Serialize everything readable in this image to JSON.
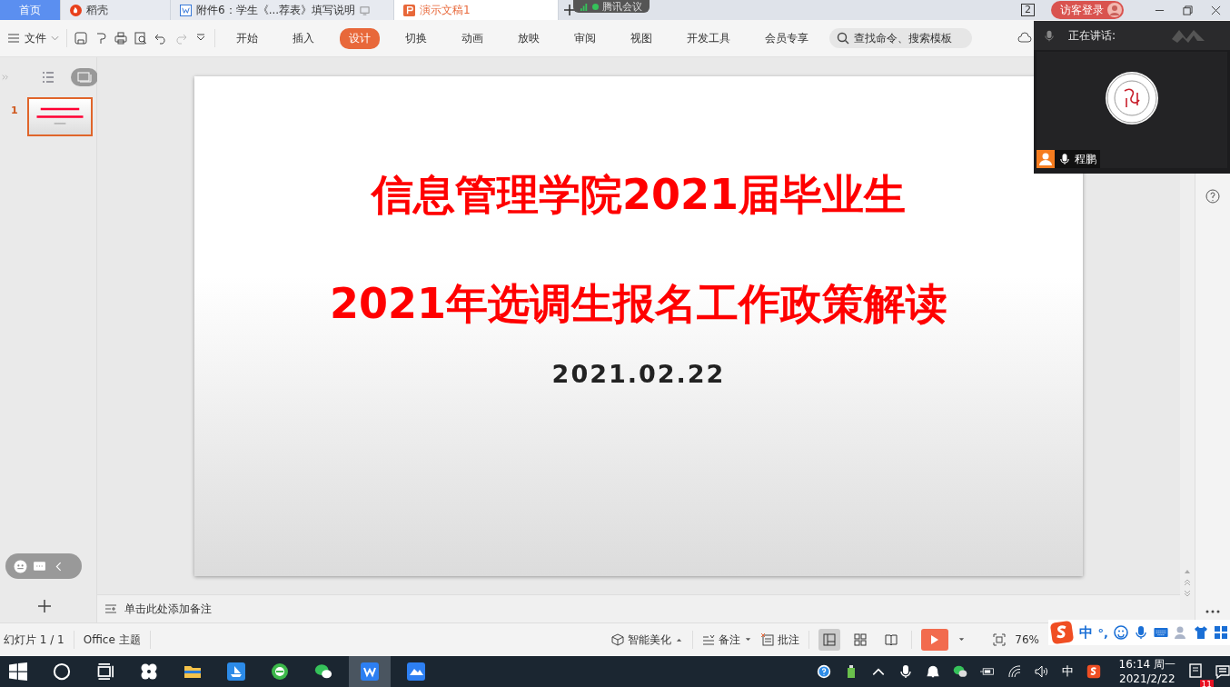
{
  "tabs": [
    {
      "label": "首页",
      "selected": false,
      "kind": "home"
    },
    {
      "label": "稻壳",
      "selected": false,
      "kind": "docer"
    },
    {
      "label": "附件6：学生《...荐表》填写说明",
      "selected": false,
      "kind": "writer"
    },
    {
      "label": "演示文稿1",
      "selected": true,
      "kind": "slides"
    }
  ],
  "meeting_pill": {
    "label": "腾讯会议"
  },
  "window_count": "2",
  "login_button": "访客登录",
  "file_menu": "文件",
  "ribbon_tabs": [
    {
      "label": "开始",
      "selected": false
    },
    {
      "label": "插入",
      "selected": false
    },
    {
      "label": "设计",
      "selected": true
    },
    {
      "label": "切换",
      "selected": false
    },
    {
      "label": "动画",
      "selected": false
    },
    {
      "label": "放映",
      "selected": false
    },
    {
      "label": "审阅",
      "selected": false
    },
    {
      "label": "视图",
      "selected": false
    },
    {
      "label": "开发工具",
      "selected": false
    },
    {
      "label": "会员专享",
      "selected": false
    }
  ],
  "search": {
    "placeholder": "查找命令、搜索模板"
  },
  "meeting": {
    "speaking_label": "正在讲话:",
    "participant": "程鹏"
  },
  "pane_views": [
    {
      "kind": "outline",
      "selected": false
    },
    {
      "kind": "slides",
      "selected": true
    }
  ],
  "slide_list": [
    {
      "number": "1",
      "selected": true
    }
  ],
  "slide": {
    "title_lines": [
      "信息管理学院2021届毕业生",
      "2021年选调生报名工作政策解读"
    ],
    "date": "2021.02.22"
  },
  "notes_placeholder": "单击此处添加备注",
  "status": {
    "slide_count": "幻灯片 1 / 1",
    "theme": "Office 主题",
    "beautify": "智能美化",
    "notes": "备注",
    "comments": "批注",
    "zoom": "76%"
  },
  "view_modes": [
    {
      "kind": "normal",
      "selected": true
    },
    {
      "kind": "sorter",
      "selected": false
    },
    {
      "kind": "reading",
      "selected": false
    }
  ],
  "ime": {
    "mode": "中",
    "punct": "°,"
  },
  "taskbar": {
    "ime": "中",
    "time": "16:14 周一",
    "date": "2021/2/22",
    "notification_count": "11"
  }
}
